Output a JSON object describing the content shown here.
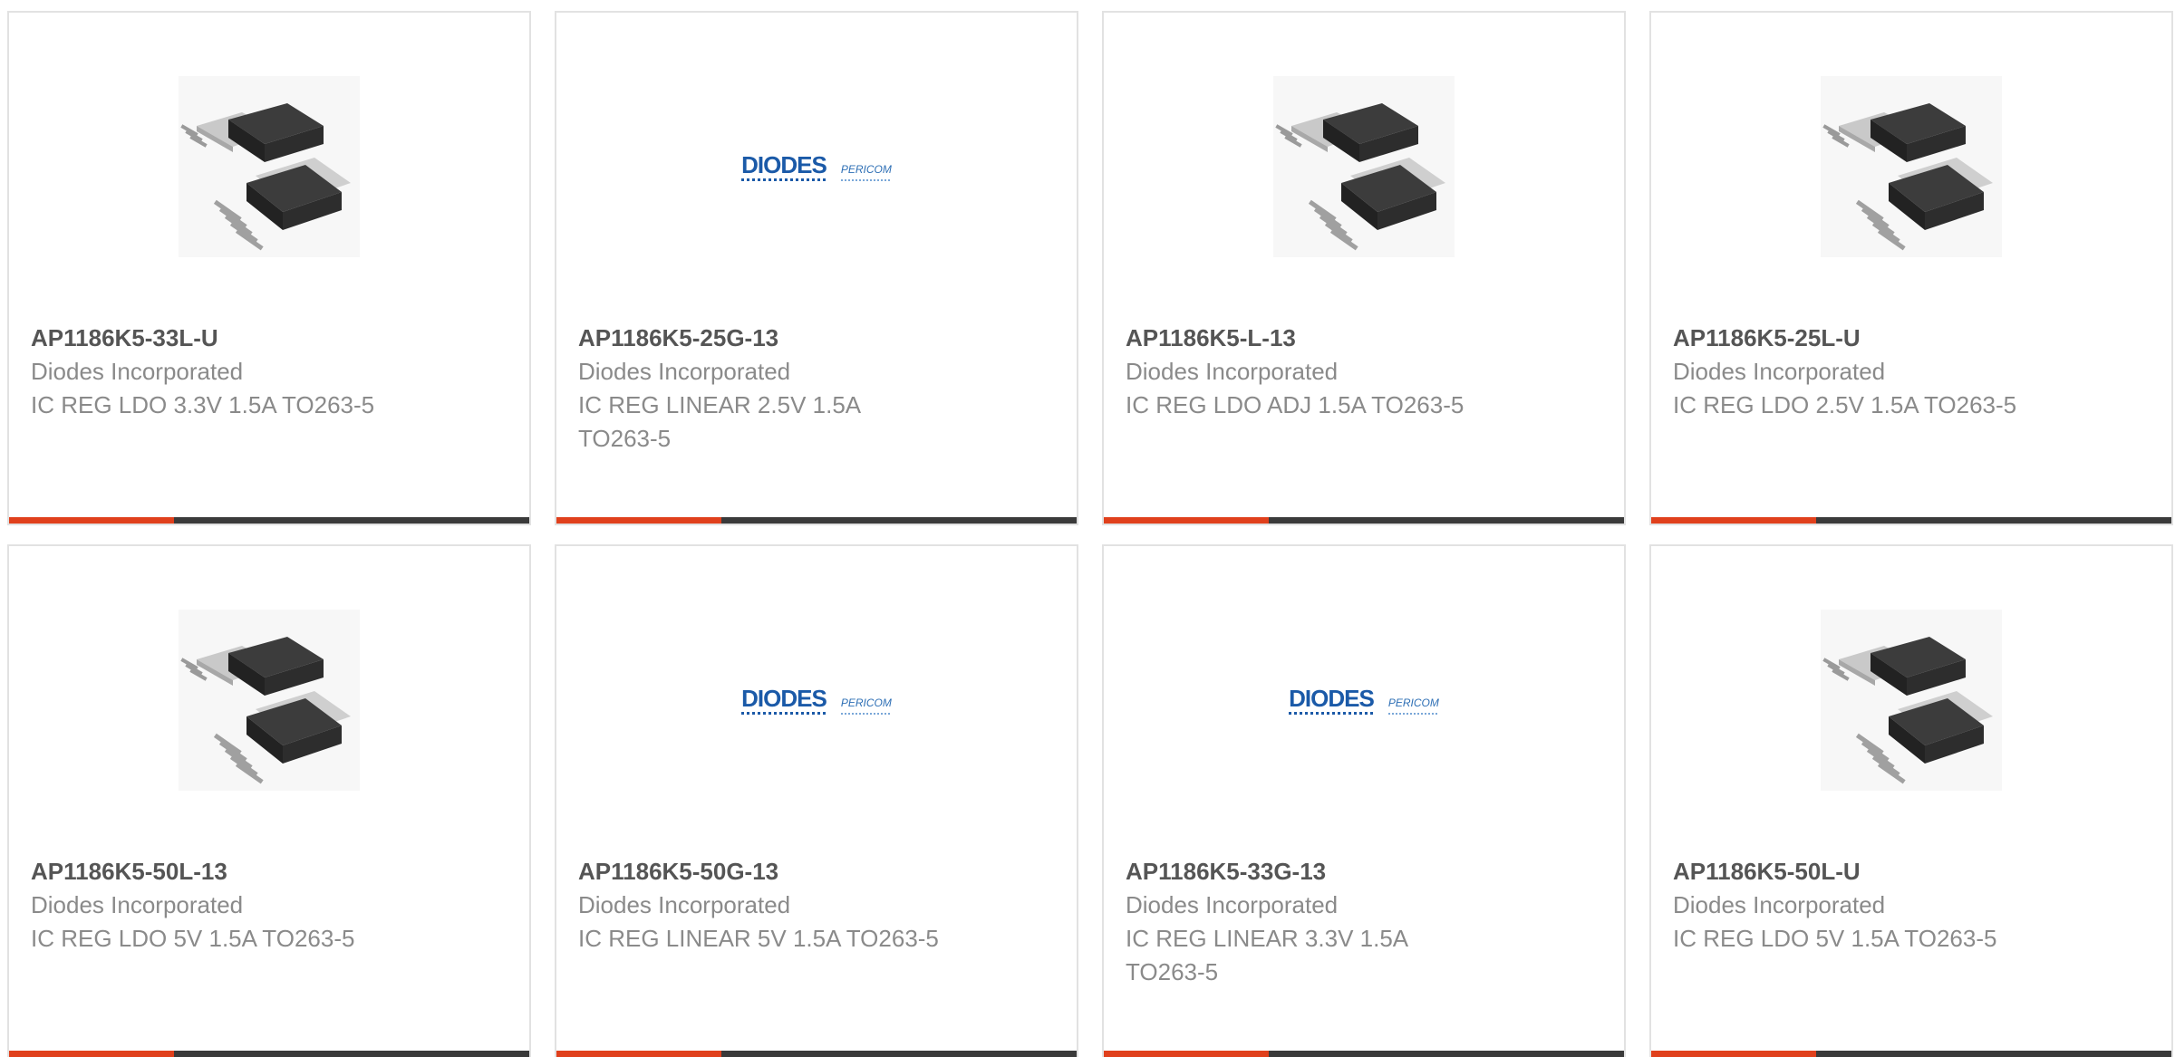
{
  "products": [
    {
      "part_number": "AP1186K5-33L-U",
      "manufacturer": "Diodes Incorporated",
      "description": "IC REG LDO 3.3V 1.5A TO263-5",
      "image": "to263-5-package-photo"
    },
    {
      "part_number": "AP1186K5-25G-13",
      "manufacturer": "Diodes Incorporated",
      "description": "IC REG LINEAR 2.5V 1.5A TO263-5",
      "image": "diodes-pericom-logo"
    },
    {
      "part_number": "AP1186K5-L-13",
      "manufacturer": "Diodes Incorporated",
      "description": "IC REG LDO ADJ 1.5A TO263-5",
      "image": "to263-5-package-photo"
    },
    {
      "part_number": "AP1186K5-25L-U",
      "manufacturer": "Diodes Incorporated",
      "description": "IC REG LDO 2.5V 1.5A TO263-5",
      "image": "to263-5-package-photo"
    },
    {
      "part_number": "AP1186K5-50L-13",
      "manufacturer": "Diodes Incorporated",
      "description": "IC REG LDO 5V 1.5A TO263-5",
      "image": "to263-5-package-photo"
    },
    {
      "part_number": "AP1186K5-50G-13",
      "manufacturer": "Diodes Incorporated",
      "description": "IC REG LINEAR 5V 1.5A TO263-5",
      "image": "diodes-pericom-logo"
    },
    {
      "part_number": "AP1186K5-33G-13",
      "manufacturer": "Diodes Incorporated",
      "description": "IC REG LINEAR 3.3V 1.5A TO263-5",
      "image": "diodes-pericom-logo"
    },
    {
      "part_number": "AP1186K5-50L-U",
      "manufacturer": "Diodes Incorporated",
      "description": "IC REG LDO 5V 1.5A TO263-5",
      "image": "to263-5-package-photo"
    }
  ],
  "logo": {
    "diodes_text": "DIODES",
    "pericom_text": "PERICOM"
  },
  "colors": {
    "accent_bar": "#e0401c",
    "bar_dark": "#3a3a3a",
    "diodes_blue": "#1b5aa8"
  }
}
